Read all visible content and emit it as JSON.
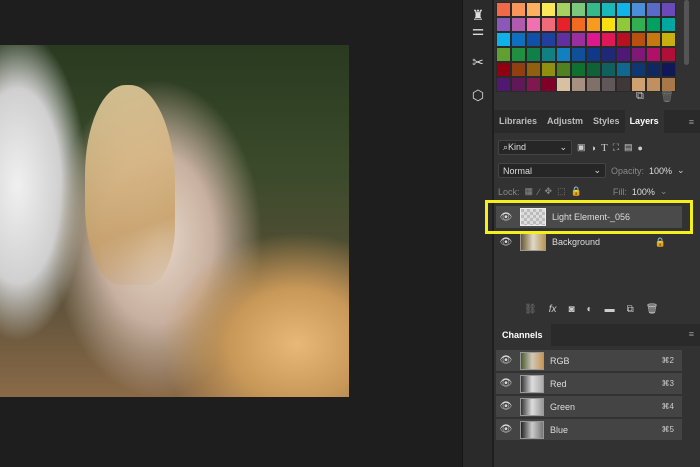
{
  "swatches": [
    "#f06a4a",
    "#f7955a",
    "#fbb060",
    "#fbe85a",
    "#a8d060",
    "#7cc87c",
    "#35b88a",
    "#1ab8b8",
    "#10b4e8",
    "#4c8ed8",
    "#5a6ac8",
    "#6a4ab8",
    "#8a58b8",
    "#b05ab0",
    "#f070b0",
    "#f06a7a",
    "#e8202a",
    "#f06a20",
    "#f89a20",
    "#f8e010",
    "#90c838",
    "#30b050",
    "#00a060",
    "#00a8a0",
    "#10b0e8",
    "#1070c0",
    "#1050a8",
    "#2040a0",
    "#6030a0",
    "#9a30a0",
    "#e01890",
    "#e01858",
    "#b81020",
    "#b85010",
    "#c87810",
    "#c8b010",
    "#60a030",
    "#209040",
    "#10804a",
    "#108080",
    "#1080c0",
    "#10509a",
    "#103888",
    "#202878",
    "#501878",
    "#801878",
    "#b01068",
    "#b01038",
    "#900010",
    "#904010",
    "#906010",
    "#909010",
    "#508020",
    "#107030",
    "#106038",
    "#106060",
    "#106890",
    "#103870",
    "#102860",
    "#101858",
    "#501870",
    "#601858",
    "#801850",
    "#800028",
    "#d8c0a0",
    "#a89080",
    "#807068",
    "#605858",
    "#403838",
    "#d0a070",
    "#c09060",
    "#a87848"
  ],
  "tabs": [
    "Libraries",
    "Adjustm",
    "Styles",
    "Layers"
  ],
  "filter": {
    "kind": "Kind"
  },
  "blend": {
    "mode": "Normal",
    "opacity_label": "Opacity:",
    "opacity": "100%"
  },
  "lock": {
    "label": "Lock:",
    "fill_label": "Fill:",
    "fill": "100%"
  },
  "layers": [
    {
      "name": "Light Element-_056"
    },
    {
      "name": "Background"
    }
  ],
  "channels_title": "Channels",
  "channels": [
    {
      "name": "RGB",
      "shortcut": "⌘2"
    },
    {
      "name": "Red",
      "shortcut": "⌘3"
    },
    {
      "name": "Green",
      "shortcut": "⌘4"
    },
    {
      "name": "Blue",
      "shortcut": "⌘5"
    }
  ],
  "highlight_color": "#f5ef1c"
}
